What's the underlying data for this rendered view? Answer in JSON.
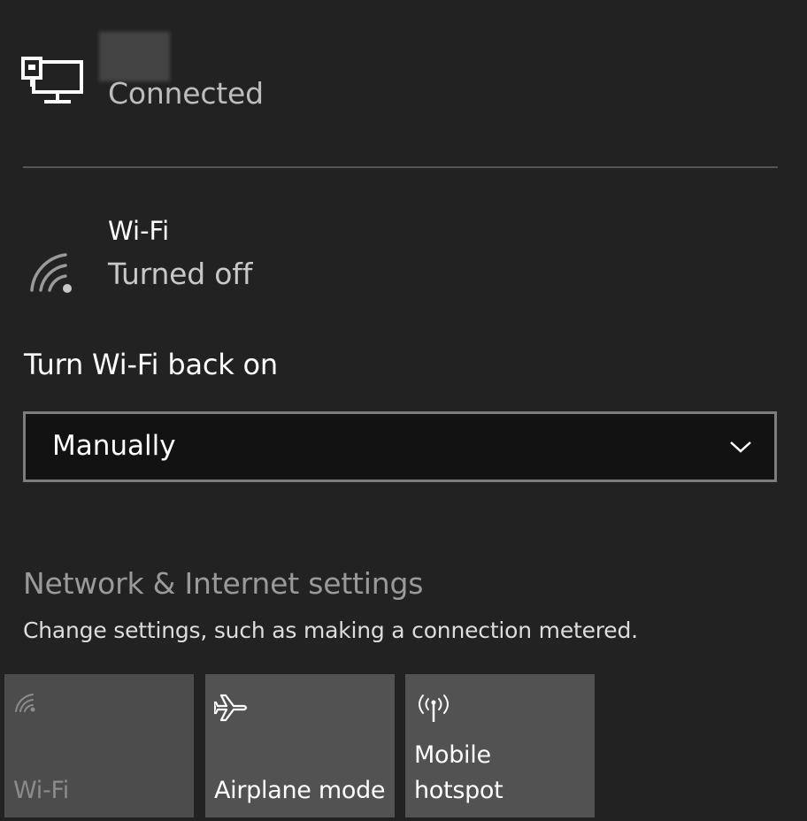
{
  "ethernet": {
    "status": "Connected",
    "icon": "ethernet-pc-icon"
  },
  "wifi": {
    "title": "Wi-Fi",
    "status": "Turned off",
    "icon": "wifi-icon"
  },
  "turn_back_on": {
    "label": "Turn Wi-Fi back on",
    "selected": "Manually"
  },
  "settings": {
    "title": "Network & Internet settings",
    "description": "Change settings, such as making a connection metered."
  },
  "quick_actions": [
    {
      "label": "Wi-Fi",
      "icon": "wifi-icon",
      "state": "off"
    },
    {
      "label": "Airplane mode",
      "icon": "airplane-icon",
      "state": "off"
    },
    {
      "label": "Mobile\nhotspot",
      "icon": "hotspot-icon",
      "state": "off"
    }
  ]
}
